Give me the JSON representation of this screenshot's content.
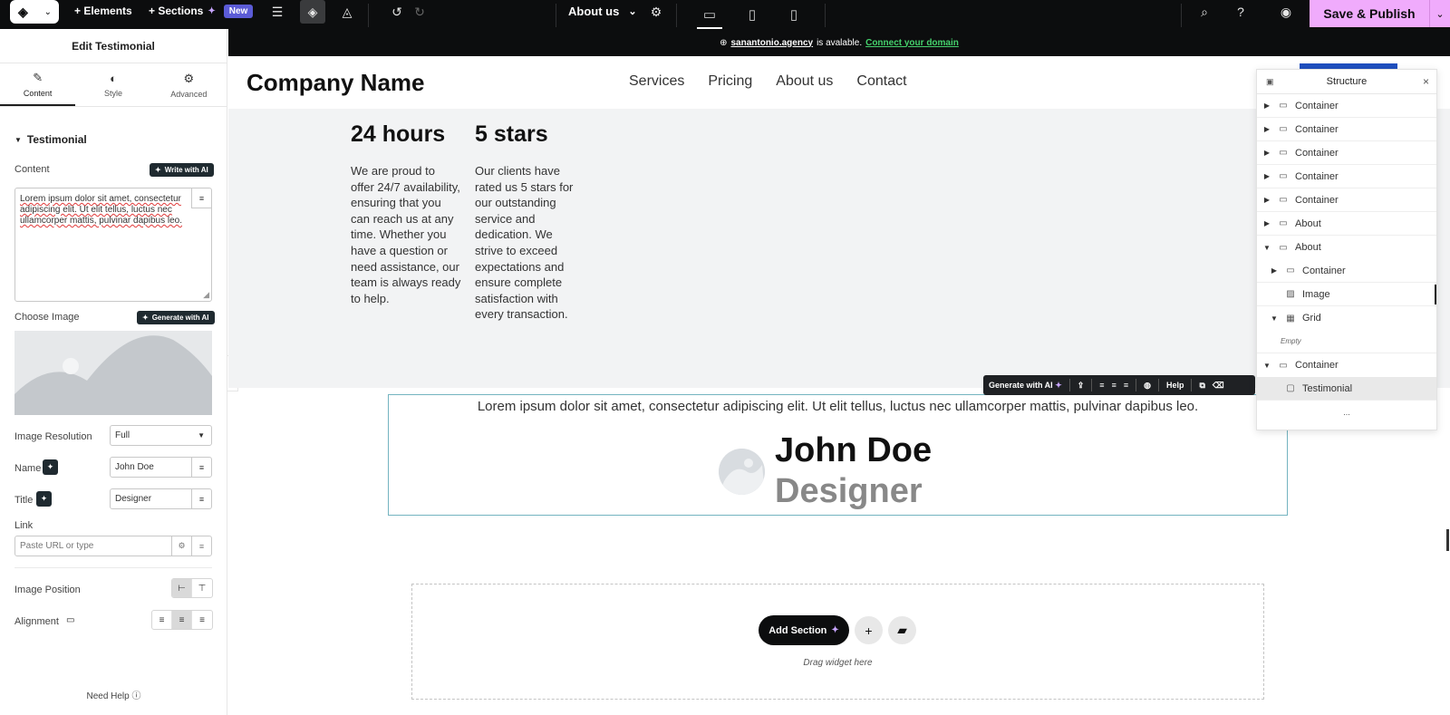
{
  "topbar": {
    "elements_label": "+ Elements",
    "sections_label": "+ Sections",
    "new_badge": "New",
    "page_name": "About us",
    "save_label": "Save & Publish"
  },
  "panel": {
    "title": "Edit Testimonial",
    "tabs": [
      {
        "label": "Content",
        "icon": "pencil-icon"
      },
      {
        "label": "Style",
        "icon": "contrast-icon"
      },
      {
        "label": "Advanced",
        "icon": "gear-icon"
      }
    ],
    "section": "Testimonial",
    "content_label": "Content",
    "write_ai": "Write with AI",
    "content_value": "Lorem ipsum dolor sit amet, consectetur adipiscing elit. Ut elit tellus, luctus nec ullamcorper mattis, pulvinar dapibus leo.",
    "choose_image_label": "Choose Image",
    "generate_ai": "Generate with AI",
    "resolution_label": "Image Resolution",
    "resolution_value": "Full",
    "name_label": "Name",
    "name_value": "John Doe",
    "title_label": "Title",
    "title_value": "Designer",
    "link_label": "Link",
    "link_placeholder": "Paste URL or type",
    "position_label": "Image Position",
    "alignment_label": "Alignment",
    "need_help": "Need Help"
  },
  "domain_bar": {
    "domain": "sanantonio.agency",
    "available": "is avalable.",
    "connect": "Connect your domain"
  },
  "site": {
    "company": "Company Name",
    "nav": [
      "Services",
      "Pricing",
      "About us",
      "Contact"
    ],
    "stats": [
      {
        "title": "24 hours",
        "body": "We are proud to offer 24/7 availability, ensuring that you can reach us at any time. Whether you have a question or need assistance, our team is always ready to help."
      },
      {
        "title": "5 stars",
        "body": "Our clients have rated us 5 stars for our outstanding service and dedication. We strive to exceed expectations and ensure complete satisfaction with every transaction."
      }
    ]
  },
  "testimonial": {
    "quote": "Lorem ipsum dolor sit amet, consectetur adipiscing elit. Ut elit tellus, luctus nec ullamcorper mattis, pulvinar dapibus leo.",
    "name": "John Doe",
    "title": "Designer"
  },
  "ai_toolbar": {
    "generate": "Generate with AI",
    "help": "Help"
  },
  "drop": {
    "add_section": "Add Section",
    "drag_text": "Drag widget here"
  },
  "structure": {
    "title": "Structure",
    "rows": [
      {
        "label": "Container"
      },
      {
        "label": "Container"
      },
      {
        "label": "Container"
      },
      {
        "label": "Container"
      },
      {
        "label": "Container"
      },
      {
        "label": "About"
      },
      {
        "label": "About"
      },
      {
        "label": "Container"
      },
      {
        "label": "Image"
      },
      {
        "label": "Grid"
      },
      {
        "label": "Empty"
      },
      {
        "label": "Container"
      },
      {
        "label": "Testimonial"
      }
    ],
    "more": "..."
  }
}
